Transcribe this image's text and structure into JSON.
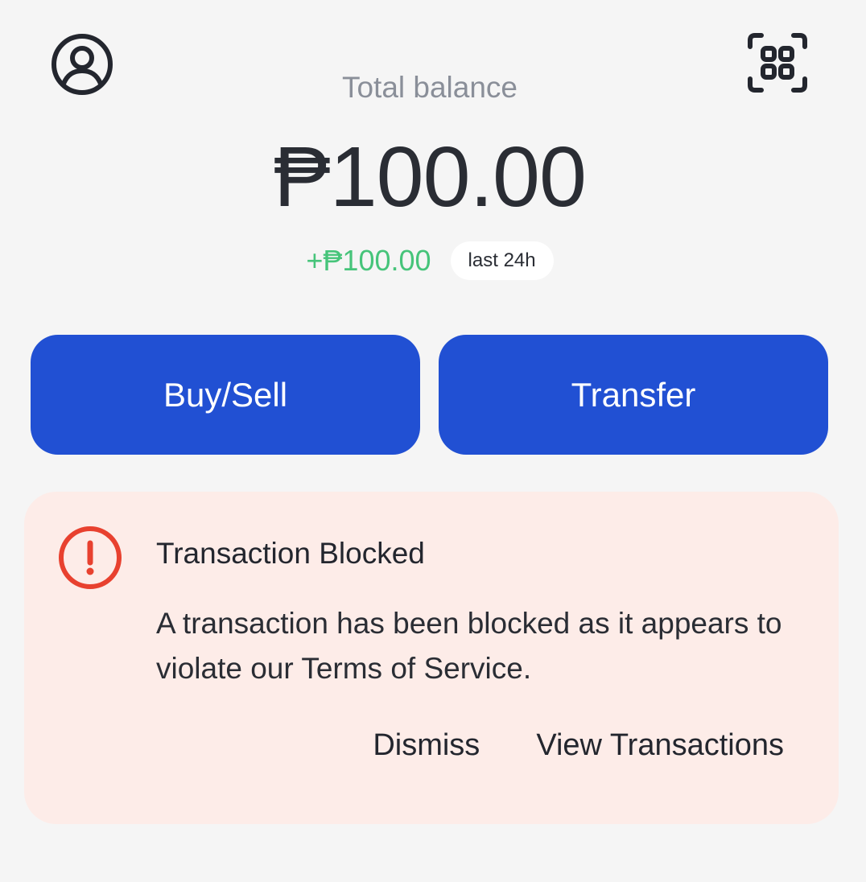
{
  "header": {
    "profile_icon": "user-circle-icon",
    "scan_icon": "qr-scan-icon"
  },
  "balance": {
    "label": "Total balance",
    "amount": "₱100.00",
    "change": "+₱100.00",
    "period": "last 24h"
  },
  "actions": {
    "buy_sell_label": "Buy/Sell",
    "transfer_label": "Transfer"
  },
  "alert": {
    "icon": "warning-circle-icon",
    "title": "Transaction Blocked",
    "message": "A transaction has been blocked as it appears to violate our Terms of Service.",
    "dismiss_label": "Dismiss",
    "view_label": "View Transactions"
  },
  "colors": {
    "background": "#f5f5f5",
    "primary": "#2150d3",
    "positive": "#46c47a",
    "alert_background": "#fdece8",
    "alert_accent": "#e8412f"
  }
}
